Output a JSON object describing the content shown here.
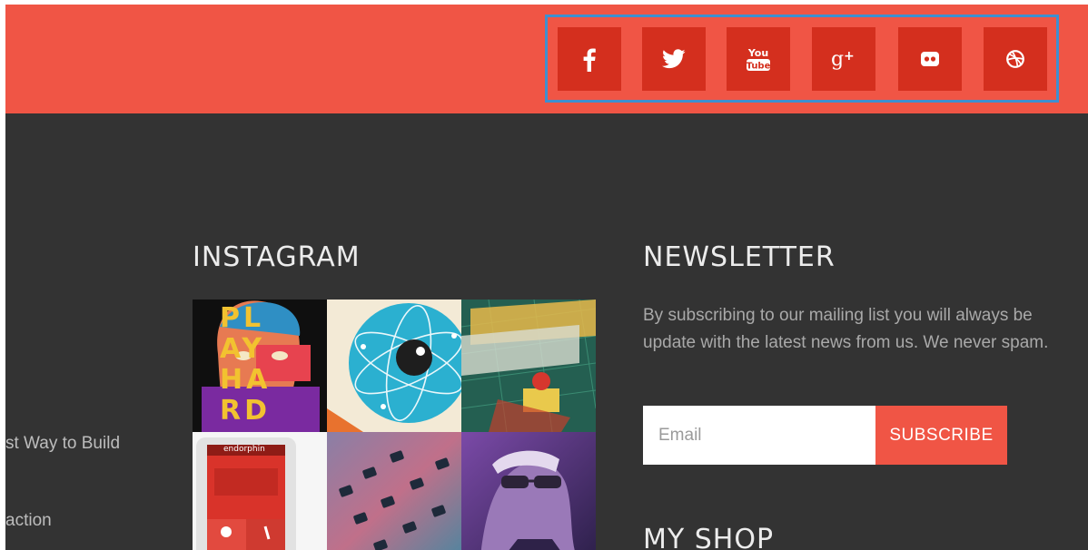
{
  "colors": {
    "accent": "#f05545",
    "social_button": "#d42f1e",
    "footer_bg": "#333333",
    "highlight_border": "#3e8fd0"
  },
  "social": [
    {
      "name": "facebook",
      "icon": "facebook-icon"
    },
    {
      "name": "twitter",
      "icon": "twitter-icon"
    },
    {
      "name": "youtube",
      "icon": "youtube-icon"
    },
    {
      "name": "google-plus",
      "icon": "google-plus-icon"
    },
    {
      "name": "flickr",
      "icon": "flickr-icon"
    },
    {
      "name": "dribbble",
      "icon": "dribbble-icon"
    }
  ],
  "left_column": {
    "items": [
      "st Way to Build",
      "action"
    ]
  },
  "instagram": {
    "title": "INSTAGRAM",
    "tiles": [
      "PL AY HA RD",
      "",
      "",
      "endorphin",
      "",
      ""
    ]
  },
  "newsletter": {
    "title": "NEWSLETTER",
    "text": "By subscribing to our mailing list you will always be update with the latest news from us. We never spam.",
    "email_placeholder": "Email",
    "subscribe_label": "SUBSCRIBE"
  },
  "shop": {
    "title": "MY SHOP"
  }
}
